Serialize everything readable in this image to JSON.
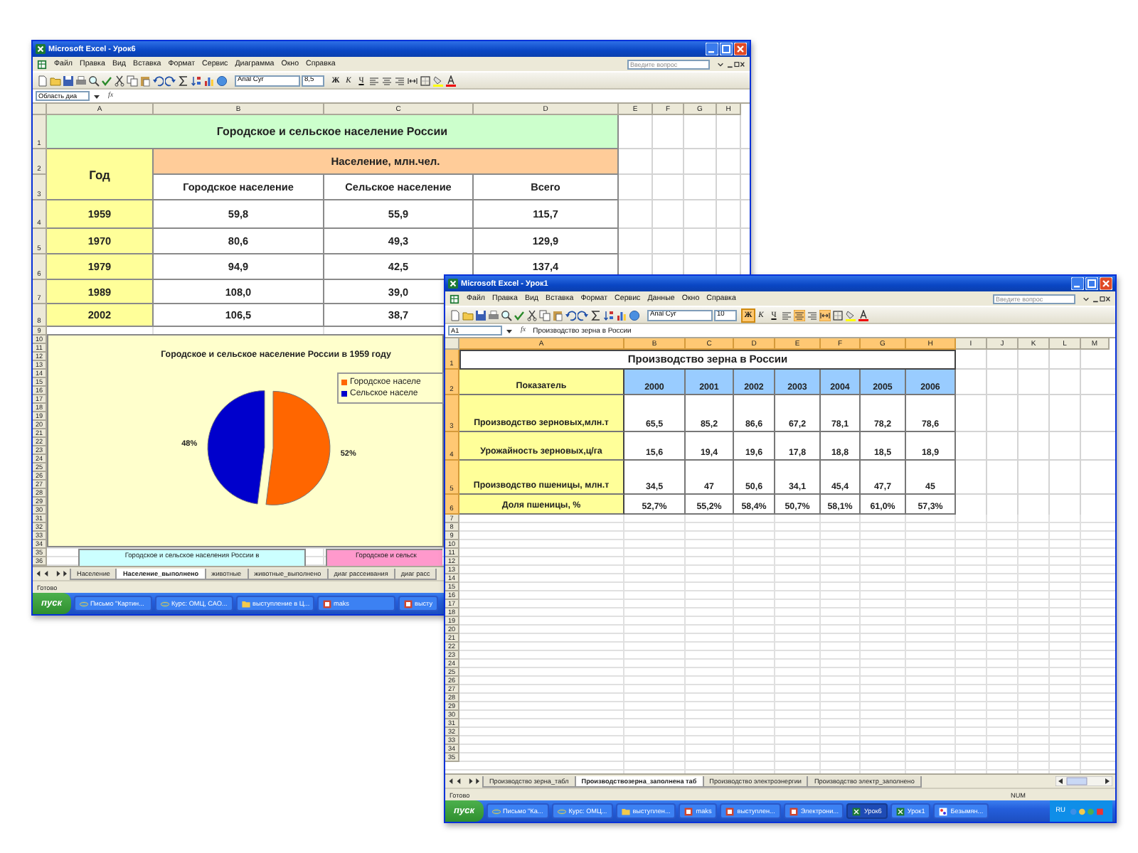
{
  "windows": [
    {
      "kind": "population",
      "title": "Microsoft Excel - Урок6",
      "menu": [
        "Файл",
        "Правка",
        "Вид",
        "Вставка",
        "Формат",
        "Сервис",
        "Диаграмма",
        "Окно",
        "Справка"
      ],
      "help_placeholder": "Введите вопрос",
      "font": "Arial Cyr",
      "font_size": "8,5",
      "format_buttons": [
        {
          "label": "Ж",
          "pressed": false
        },
        {
          "label": "К",
          "pressed": false
        },
        {
          "label": "Ч",
          "pressed": false
        }
      ],
      "align_buttons": [
        {
          "kind": "left",
          "pressed": false
        },
        {
          "kind": "center",
          "pressed": false
        },
        {
          "kind": "right",
          "pressed": false
        },
        {
          "kind": "merge",
          "pressed": false
        }
      ],
      "name_box": "Область диа",
      "function_label": "fx",
      "columns": [
        {
          "label": "A",
          "selected": false
        },
        {
          "label": "B",
          "selected": false
        },
        {
          "label": "C",
          "selected": false
        },
        {
          "label": "D",
          "selected": false
        },
        {
          "label": "E",
          "selected": false
        },
        {
          "label": "F",
          "selected": false
        },
        {
          "label": "G",
          "selected": false
        },
        {
          "label": "H",
          "selected": false
        }
      ],
      "row_headers": [
        {
          "label": "1",
          "selected": false
        },
        {
          "label": "2",
          "selected": false
        },
        {
          "label": "3",
          "selected": false
        },
        {
          "label": "4",
          "selected": false
        },
        {
          "label": "5",
          "selected": false
        },
        {
          "label": "6",
          "selected": false
        },
        {
          "label": "7",
          "selected": false
        },
        {
          "label": "8",
          "selected": false
        }
      ],
      "table": {
        "title": "Городское и сельское население России",
        "year_header": "Год",
        "group_header": "Население, млн.чел.",
        "subheaders": [
          "Городское население",
          "Сельское население",
          "Всего"
        ],
        "rows": [
          {
            "year": "1959",
            "values": [
              "59,8",
              "55,9",
              "115,7"
            ]
          },
          {
            "year": "1970",
            "values": [
              "80,6",
              "49,3",
              "129,9"
            ]
          },
          {
            "year": "1979",
            "values": [
              "94,9",
              "42,5",
              "137,4"
            ]
          },
          {
            "year": "1989",
            "values": [
              "108,0",
              "39,0"
            ]
          },
          {
            "year": "2002",
            "values": [
              "106,5",
              "38,7"
            ]
          }
        ]
      },
      "rows_below": [
        "9",
        "10",
        "11",
        "12",
        "13",
        "14",
        "15",
        "16",
        "17",
        "18",
        "19",
        "20",
        "21",
        "22",
        "23",
        "24",
        "25",
        "26",
        "27",
        "28",
        "29",
        "30",
        "31",
        "32",
        "33",
        "34",
        "35",
        "36"
      ],
      "chart": {
        "chart_data": {
          "type": "pie",
          "legend": "right",
          "title": "Городское и сельское население России в 1959 году",
          "categories": [
            "Городское населе",
            "Сельское населе"
          ],
          "colors": [
            "#ff6600",
            "#0000cc"
          ],
          "values": [
            52,
            48
          ],
          "data_labels": true,
          "value_labels": [
            "52%",
            "48%"
          ]
        }
      },
      "shapes": [
        {
          "text": "Городское и сельское населения России в",
          "color": "#ccffff"
        },
        {
          "text": "Городское и сельск",
          "color": "#ff99cc"
        }
      ],
      "sheet_tabs": [
        {
          "label": "Население",
          "selected": false
        },
        {
          "label": "Население_выполнено",
          "selected": true
        },
        {
          "label": "животные",
          "selected": false
        },
        {
          "label": "животные_выполнено",
          "selected": false
        },
        {
          "label": "диаг рассеивания",
          "selected": false
        },
        {
          "label": "диаг расс",
          "selected": false
        }
      ],
      "status": [
        "Готово"
      ],
      "start_label": "пуск",
      "taskbar": [
        {
          "kind": "browser",
          "label": "Письмо \"Картин...",
          "selected": false
        },
        {
          "kind": "browser",
          "label": "Курс: ОМЦ, САО...",
          "selected": false
        },
        {
          "kind": "folder",
          "label": "выступление в Ц...",
          "selected": false
        },
        {
          "kind": "slides",
          "label": "maks",
          "selected": false
        },
        {
          "kind": "slides",
          "label": "высту",
          "selected": false
        }
      ]
    },
    {
      "kind": "grain",
      "title": "Microsoft Excel - Урок1",
      "menu": [
        "Файл",
        "Правка",
        "Вид",
        "Вставка",
        "Формат",
        "Сервис",
        "Данные",
        "Окно",
        "Справка"
      ],
      "help_placeholder": "Введите вопрос",
      "font": "Arial Cyr",
      "font_size": "10",
      "format_buttons": [
        {
          "label": "Ж",
          "pressed": true
        },
        {
          "label": "К",
          "pressed": false
        },
        {
          "label": "Ч",
          "pressed": false
        }
      ],
      "align_buttons": [
        {
          "kind": "left",
          "pressed": false
        },
        {
          "kind": "center",
          "pressed": true
        },
        {
          "kind": "right",
          "pressed": false
        },
        {
          "kind": "merge",
          "pressed": true
        }
      ],
      "name_box": "A1",
      "function_label": "fx",
      "formula": "Производство зерна в России",
      "columns": [
        {
          "label": "A",
          "selected": true
        },
        {
          "label": "B",
          "selected": true
        },
        {
          "label": "C",
          "selected": true
        },
        {
          "label": "D",
          "selected": true
        },
        {
          "label": "E",
          "selected": true
        },
        {
          "label": "F",
          "selected": true
        },
        {
          "label": "G",
          "selected": true
        },
        {
          "label": "H",
          "selected": true
        },
        {
          "label": "I",
          "selected": false
        },
        {
          "label": "J",
          "selected": false
        },
        {
          "label": "K",
          "selected": false
        },
        {
          "label": "L",
          "selected": false
        },
        {
          "label": "M",
          "selected": false
        }
      ],
      "row_headers": [
        {
          "label": "1",
          "selected": true
        },
        {
          "label": "2",
          "selected": true
        },
        {
          "label": "3",
          "selected": true
        },
        {
          "label": "4",
          "selected": true
        },
        {
          "label": "5",
          "selected": true
        },
        {
          "label": "6",
          "selected": true
        }
      ],
      "table": {
        "title": "Производство зерна в России",
        "label_header": "Показатель",
        "years": [
          "2000",
          "2001",
          "2002",
          "2003",
          "2004",
          "2005",
          "2006"
        ],
        "rows": [
          {
            "label": "Производство зерновых,млн.т",
            "values": [
              "65,5",
              "85,2",
              "86,6",
              "67,2",
              "78,1",
              "78,2",
              "78,6"
            ]
          },
          {
            "label": "Урожайность зерновых,ц/га",
            "values": [
              "15,6",
              "19,4",
              "19,6",
              "17,8",
              "18,8",
              "18,5",
              "18,9"
            ]
          },
          {
            "label": "Производство пшеницы, млн.т",
            "values": [
              "34,5",
              "47",
              "50,6",
              "34,1",
              "45,4",
              "47,7",
              "45"
            ]
          },
          {
            "label": "Доля пшеницы, %",
            "values": [
              "52,7%",
              "55,2%",
              "58,4%",
              "50,7%",
              "58,1%",
              "61,0%",
              "57,3%"
            ]
          }
        ]
      },
      "rows_below": [
        "7",
        "8",
        "9",
        "10",
        "11",
        "12",
        "13",
        "14",
        "15",
        "16",
        "17",
        "18",
        "19",
        "20",
        "21",
        "22",
        "23",
        "24",
        "25",
        "26",
        "27",
        "28",
        "29",
        "30",
        "31",
        "32",
        "33",
        "34",
        "35"
      ],
      "sheet_tabs": [
        {
          "label": "Производство зерна_табл",
          "selected": false
        },
        {
          "label": "Производствозерна_заполнена таб",
          "selected": true
        },
        {
          "label": "Производство электроэнергии",
          "selected": false
        },
        {
          "label": "Производство электр_заполнено",
          "selected": false
        }
      ],
      "status": [
        "Готово",
        "NUM"
      ],
      "start_label": "пуск",
      "taskbar": [
        {
          "kind": "browser",
          "label": "Письмо \"Ка...",
          "selected": false
        },
        {
          "kind": "browser",
          "label": "Курс: ОМЦ...",
          "selected": false
        },
        {
          "kind": "folder",
          "label": "выступлен...",
          "selected": false
        },
        {
          "kind": "slides",
          "label": "maks",
          "selected": false
        },
        {
          "kind": "slides",
          "label": "выступлен...",
          "selected": false
        },
        {
          "kind": "slides",
          "label": "Электрони...",
          "selected": false
        },
        {
          "kind": "sheet",
          "label": "Урок6",
          "selected": true
        },
        {
          "kind": "sheet",
          "label": "Урок1",
          "selected": false
        },
        {
          "kind": "paint",
          "label": "Безымян...",
          "selected": false
        }
      ],
      "tray_language": "RU"
    }
  ]
}
